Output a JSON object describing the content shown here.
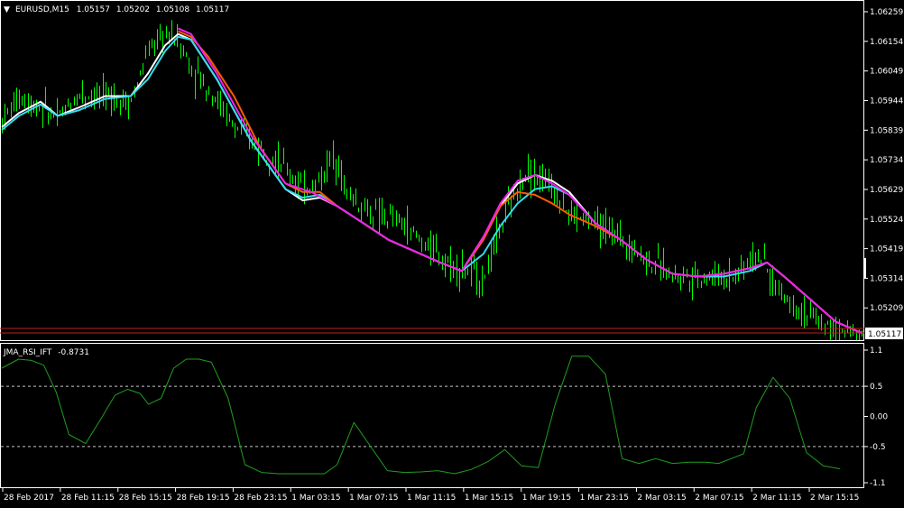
{
  "header": {
    "symbol": "EURUSD,M15",
    "open": "1.05157",
    "high": "1.05202",
    "low": "1.05108",
    "close": "1.05117"
  },
  "indicator": {
    "name": "JMA_RSI_IFT",
    "value": "-0.8731"
  },
  "colors": {
    "background": "#000000",
    "frame": "#ffffff",
    "candle": "#00ff00",
    "ma_white": "#ffffff",
    "ma_cyan": "#33ddee",
    "ma_orange": "#ff5a00",
    "ma_magenta": "#ee22ee",
    "ma_red": "#ff2a2a",
    "indicator_line": "#1f9e1f",
    "level_line": "#c8c8c8",
    "price_line": "#c02020",
    "price_tag": "#ffffff"
  },
  "chart_data": [
    {
      "type": "line",
      "ylim": [
        1.05117,
        1.06259
      ],
      "y_ticks": [
        "1.06259",
        "1.06154",
        "1.06049",
        "1.05944",
        "1.05839",
        "1.05734",
        "1.05629",
        "1.05524",
        "1.05419",
        "1.05314",
        "1.05209"
      ],
      "current_price": "1.05117",
      "x_ticks": [
        "28 Feb 2017",
        "28 Feb 11:15",
        "28 Feb 15:15",
        "28 Feb 19:15",
        "28 Feb 23:15",
        "1 Mar 03:15",
        "1 Mar 07:15",
        "1 Mar 11:15",
        "1 Mar 15:15",
        "1 Mar 19:15",
        "1 Mar 23:15",
        "2 Mar 03:15",
        "2 Mar 07:15",
        "2 Mar 11:15",
        "2 Mar 15:15"
      ],
      "tick_x": [
        0,
        0.0714,
        0.1429,
        0.2143,
        0.2857,
        0.3571,
        0.4286,
        0.5,
        0.5714,
        0.6429,
        0.7143,
        0.7857,
        0.8571,
        0.9286,
        1.0
      ],
      "candle_path_x": [
        0,
        0.02,
        0.045,
        0.065,
        0.09,
        0.12,
        0.15,
        0.17,
        0.19,
        0.205,
        0.22,
        0.245,
        0.27,
        0.31,
        0.33,
        0.35,
        0.37,
        0.38,
        0.39,
        0.4,
        0.43,
        0.46,
        0.49,
        0.52,
        0.56,
        0.58,
        0.61,
        0.64,
        0.66,
        0.69,
        0.72,
        0.75,
        0.78,
        0.81,
        0.85,
        0.87,
        0.88,
        0.9,
        0.93,
        0.96,
        0.99,
        1.0
      ],
      "candle_path_y": [
        1.0587,
        1.0596,
        1.0592,
        1.0588,
        1.0597,
        1.0596,
        1.0594,
        1.0612,
        1.0618,
        1.0616,
        1.0606,
        1.0597,
        1.0585,
        1.0576,
        1.057,
        1.0563,
        1.0566,
        1.0573,
        1.0575,
        1.0562,
        1.0554,
        1.0552,
        1.0544,
        1.0537,
        1.0531,
        1.055,
        1.057,
        1.0564,
        1.0554,
        1.0551,
        1.0546,
        1.0538,
        1.0533,
        1.0532,
        1.0532,
        1.0538,
        1.054,
        1.0528,
        1.052,
        1.0514,
        1.0512,
        1.0512
      ],
      "series": [
        {
          "color_key": "ma_white",
          "x": [
            0,
            0.02,
            0.045,
            0.065,
            0.09,
            0.12,
            0.15,
            0.17,
            0.19,
            0.205,
            0.22,
            0.25,
            0.29,
            0.33,
            0.35,
            0.37,
            0.39,
            0.42,
            0.45,
            0.48,
            0.51,
            0.535,
            0.56,
            0.58,
            0.6,
            0.62,
            0.64,
            0.66,
            0.69,
            0.72,
            0.75,
            0.78,
            0.81,
            0.84,
            0.87,
            0.89,
            0.91,
            0.94,
            0.97,
            1.0
          ],
          "y": [
            1.0585,
            1.059,
            1.0594,
            1.0589,
            1.0592,
            1.0596,
            1.0596,
            1.0604,
            1.0614,
            1.0618,
            1.0616,
            1.0602,
            1.058,
            1.0563,
            1.0559,
            1.056,
            1.0557,
            1.0551,
            1.0545,
            1.0541,
            1.0537,
            1.0534,
            1.0546,
            1.0557,
            1.0565,
            1.0568,
            1.0566,
            1.0562,
            1.0551,
            1.0545,
            1.0538,
            1.0533,
            1.0532,
            1.0533,
            1.0535,
            1.0537,
            1.0532,
            1.0524,
            1.0516,
            1.0512
          ]
        },
        {
          "color_key": "ma_cyan",
          "x": [
            0,
            0.02,
            0.045,
            0.065,
            0.09,
            0.12,
            0.15,
            0.17,
            0.19,
            0.205,
            0.22,
            0.25,
            0.29,
            0.33,
            0.35,
            0.37,
            0.39,
            0.42,
            0.45,
            0.48,
            0.51,
            0.535,
            0.56,
            0.58,
            0.6,
            0.62,
            0.64,
            0.66,
            0.69,
            0.72,
            0.75,
            0.78,
            0.81,
            0.84,
            0.87,
            0.89,
            0.91,
            0.94,
            0.97,
            1.0
          ],
          "y": [
            1.0584,
            1.0589,
            1.0593,
            1.0589,
            1.0591,
            1.0595,
            1.0596,
            1.0602,
            1.0612,
            1.0617,
            1.0616,
            1.0602,
            1.058,
            1.0563,
            1.056,
            1.0561,
            1.0557,
            1.0551,
            1.0545,
            1.0541,
            1.0537,
            1.0534,
            1.054,
            1.055,
            1.0558,
            1.0563,
            1.0564,
            1.0561,
            1.0551,
            1.0545,
            1.0538,
            1.0533,
            1.0532,
            1.0532,
            1.0534,
            1.0537,
            1.0532,
            1.0524,
            1.0516,
            1.0512
          ]
        },
        {
          "color_key": "ma_orange",
          "x": [
            0.205,
            0.22,
            0.24,
            0.27,
            0.3,
            0.33,
            0.35,
            0.37,
            0.39,
            0.42,
            0.45,
            0.48,
            0.51,
            0.535,
            0.56,
            0.58,
            0.6,
            0.62,
            0.64,
            0.66,
            0.69,
            0.72,
            0.75,
            0.78,
            0.81,
            0.84,
            0.87,
            0.89,
            0.91,
            0.94,
            0.97,
            1.0
          ],
          "y": [
            1.0619,
            1.0617,
            1.061,
            1.0596,
            1.0578,
            1.0565,
            1.0562,
            1.0562,
            1.0557,
            1.0551,
            1.0545,
            1.0541,
            1.0537,
            1.0534,
            1.0545,
            1.0557,
            1.0562,
            1.0561,
            1.0558,
            1.0554,
            1.055,
            1.0545,
            1.0538,
            1.0533,
            1.0532,
            1.0533,
            1.0535,
            1.0537,
            1.0532,
            1.0524,
            1.0516,
            1.0512
          ]
        },
        {
          "color_key": "ma_magenta",
          "x": [
            0.205,
            0.22,
            0.25,
            0.29,
            0.33,
            0.36,
            0.39,
            0.42,
            0.45,
            0.48,
            0.51,
            0.535,
            0.56,
            0.58,
            0.6,
            0.62,
            0.64,
            0.66,
            0.69,
            0.72,
            0.75,
            0.78,
            0.81,
            0.84,
            0.87,
            0.89,
            0.91,
            0.94,
            0.97,
            1.0
          ],
          "y": [
            1.062,
            1.0618,
            1.0604,
            1.0582,
            1.0565,
            1.0562,
            1.0557,
            1.0551,
            1.0545,
            1.0541,
            1.0537,
            1.0534,
            1.0546,
            1.0558,
            1.0566,
            1.0568,
            1.0565,
            1.0561,
            1.0551,
            1.0545,
            1.0538,
            1.0533,
            1.0532,
            1.0533,
            1.0535,
            1.0537,
            1.0532,
            1.0524,
            1.0516,
            1.0512
          ]
        }
      ]
    },
    {
      "type": "line",
      "ylim": [
        -1.1,
        1.1
      ],
      "y_ticks": [
        "1.1",
        "0.5",
        "0.00",
        "-0.5",
        "-1.1"
      ],
      "levels": [
        0.5,
        -0.5
      ],
      "series": [
        {
          "color_key": "indicator_line",
          "x": [
            0,
            0.02,
            0.035,
            0.05,
            0.065,
            0.08,
            0.1,
            0.12,
            0.135,
            0.15,
            0.165,
            0.175,
            0.19,
            0.205,
            0.22,
            0.235,
            0.25,
            0.27,
            0.29,
            0.31,
            0.33,
            0.35,
            0.37,
            0.385,
            0.4,
            0.42,
            0.44,
            0.46,
            0.48,
            0.5,
            0.52,
            0.54,
            0.56,
            0.58,
            0.6,
            0.62,
            0.64,
            0.66,
            0.68,
            0.7,
            0.72,
            0.74,
            0.76,
            0.78,
            0.8,
            0.82,
            0.84,
            0.855,
            0.87,
            0.885,
            0.9,
            0.92,
            0.94,
            0.96,
            0.98,
            1.0
          ],
          "y": [
            0.8,
            0.95,
            0.93,
            0.85,
            0.4,
            -0.3,
            -0.45,
            0.0,
            0.35,
            0.45,
            0.38,
            0.2,
            0.3,
            0.8,
            0.95,
            0.95,
            0.9,
            0.3,
            -0.8,
            -0.93,
            -0.95,
            -0.95,
            -0.95,
            -0.95,
            -0.8,
            -0.1,
            -0.5,
            -0.9,
            -0.93,
            -0.92,
            -0.9,
            -0.95,
            -0.88,
            -0.75,
            -0.55,
            -0.82,
            -0.85,
            0.2,
            1.0,
            1.0,
            0.7,
            -0.7,
            -0.78,
            -0.7,
            -0.78,
            -0.76,
            -0.76,
            -0.78,
            -0.7,
            -0.62,
            0.15,
            0.65,
            0.3,
            -0.6,
            -0.82,
            -0.87
          ]
        }
      ]
    }
  ]
}
